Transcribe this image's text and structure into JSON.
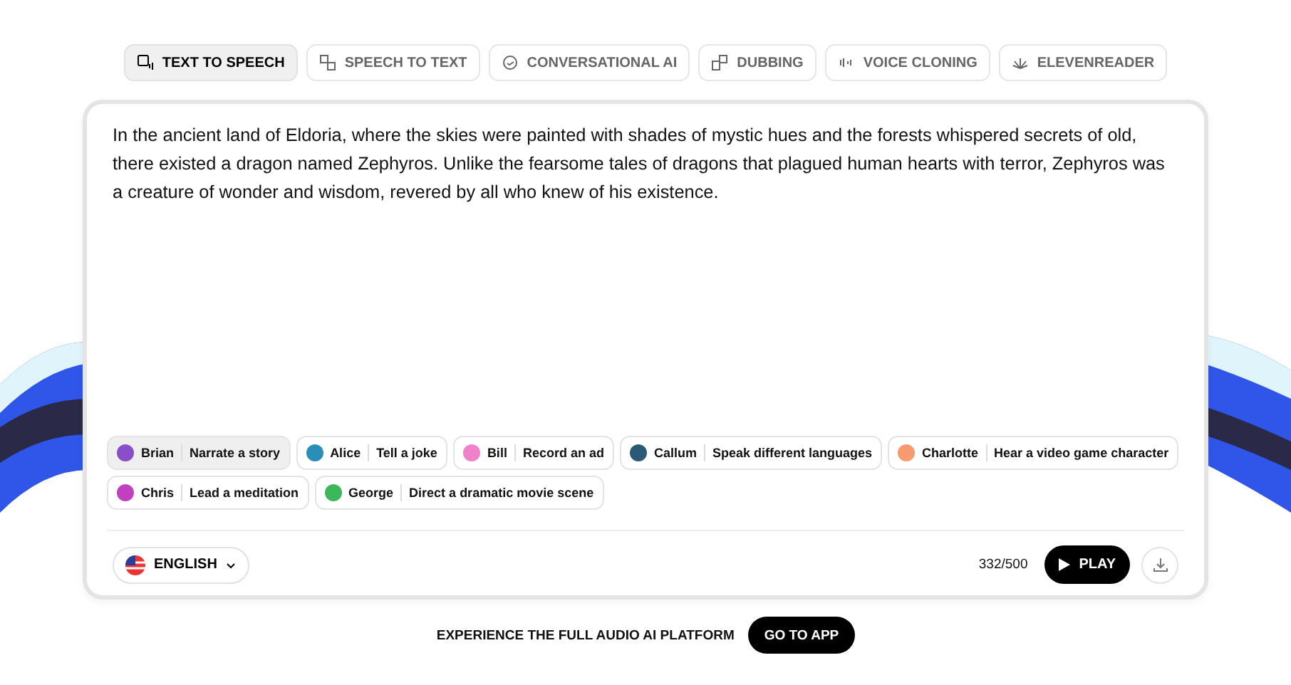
{
  "tabs": [
    {
      "label": "TEXT TO SPEECH",
      "kind": "tts",
      "selected": true
    },
    {
      "label": "SPEECH TO TEXT",
      "kind": "stt",
      "selected": false
    },
    {
      "label": "CONVERSATIONAL AI",
      "kind": "chat",
      "selected": false
    },
    {
      "label": "DUBBING",
      "kind": "dub",
      "selected": false
    },
    {
      "label": "VOICE CLONING",
      "kind": "clone",
      "selected": false
    },
    {
      "label": "ELEVENREADER",
      "kind": "reader",
      "selected": false
    }
  ],
  "text": "In the ancient land of Eldoria, where the skies were painted with shades of mystic hues and the forests whispered secrets of old, there existed a dragon named Zephyros. Unlike the fearsome tales of dragons that plagued human hearts with terror, Zephyros was a creature of wonder and wisdom, revered by all who knew of his existence.",
  "voices": [
    {
      "name": "Brian",
      "prompt": "Narrate a story",
      "color": "#8a4fc8",
      "selected": true
    },
    {
      "name": "Alice",
      "prompt": "Tell a joke",
      "color": "#2a8fb8",
      "selected": false
    },
    {
      "name": "Bill",
      "prompt": "Record an ad",
      "color": "#f080c8",
      "selected": false
    },
    {
      "name": "Callum",
      "prompt": "Speak different languages",
      "color": "#2a5a78",
      "selected": false
    },
    {
      "name": "Charlotte",
      "prompt": "Hear a video game character",
      "color": "#f89a70",
      "selected": false
    },
    {
      "name": "Chris",
      "prompt": "Lead a meditation",
      "color": "#c040c0",
      "selected": false
    },
    {
      "name": "George",
      "prompt": "Direct a dramatic movie scene",
      "color": "#3cb85a",
      "selected": false
    }
  ],
  "language": "ENGLISH",
  "counter": "332/500",
  "play": "PLAY",
  "footer": {
    "text": "EXPERIENCE THE FULL AUDIO AI PLATFORM",
    "button": "GO TO APP"
  }
}
